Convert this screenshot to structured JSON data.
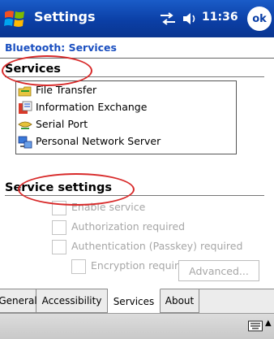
{
  "titlebar": {
    "app_title": "Settings",
    "clock": "11:36",
    "ok_label": "ok"
  },
  "page_title": "Bluetooth: Services",
  "services": {
    "label": "Services",
    "items": [
      {
        "label": "File Transfer",
        "icon": "folder-transfer-icon"
      },
      {
        "label": "Information Exchange",
        "icon": "info-exchange-icon"
      },
      {
        "label": "Serial Port",
        "icon": "serial-port-icon"
      },
      {
        "label": "Personal Network Server",
        "icon": "network-server-icon"
      }
    ]
  },
  "service_settings": {
    "label": "Service settings",
    "enable_service": "Enable service",
    "authorization": "Authorization required",
    "authentication": "Authentication (Passkey) required",
    "encryption": "Encryption required",
    "advanced": "Advanced..."
  },
  "tabs": [
    {
      "label": "General"
    },
    {
      "label": "Accessibility"
    },
    {
      "label": "Services"
    },
    {
      "label": "About"
    }
  ],
  "active_tab": "Services",
  "colors": {
    "title_bar": "#0b3fa6",
    "page_title": "#1a4fc0",
    "callout": "#d82a2a",
    "disabled_text": "#a6a6a6"
  }
}
